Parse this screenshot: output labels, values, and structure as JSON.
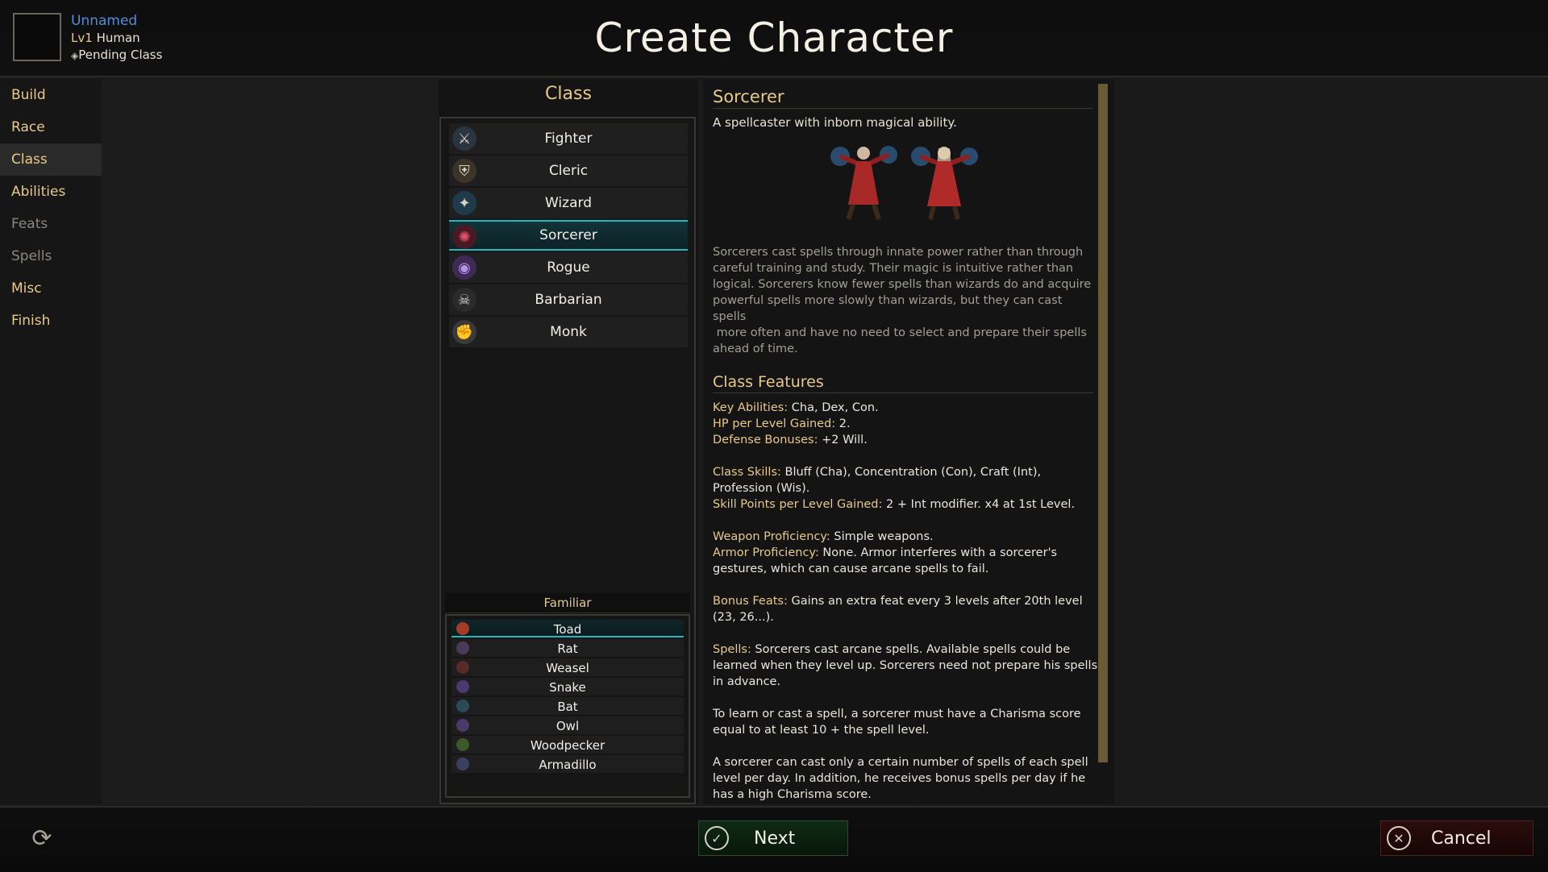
{
  "header": {
    "char_name": "Unnamed",
    "level_prefix": "Lv1",
    "race": "Human",
    "pending_class": "Pending Class",
    "title": "Create Character"
  },
  "nav": {
    "items": [
      {
        "label": "Build",
        "state": "enabled"
      },
      {
        "label": "Race",
        "state": "enabled"
      },
      {
        "label": "Class",
        "state": "active"
      },
      {
        "label": "Abilities",
        "state": "enabled"
      },
      {
        "label": "Feats",
        "state": "disabled"
      },
      {
        "label": "Spells",
        "state": "disabled"
      },
      {
        "label": "Misc",
        "state": "enabled"
      },
      {
        "label": "Finish",
        "state": "enabled"
      }
    ]
  },
  "class_panel": {
    "header": "Class",
    "classes": [
      {
        "label": "Fighter",
        "icon": "sword-icon"
      },
      {
        "label": "Cleric",
        "icon": "shield-icon"
      },
      {
        "label": "Wizard",
        "icon": "spellbook-icon"
      },
      {
        "label": "Sorcerer",
        "icon": "fire-hands-icon",
        "selected": true
      },
      {
        "label": "Rogue",
        "icon": "hood-icon"
      },
      {
        "label": "Barbarian",
        "icon": "skull-icon"
      },
      {
        "label": "Monk",
        "icon": "fist-icon"
      }
    ],
    "familiar_header": "Familiar",
    "familiars": [
      {
        "label": "Toad",
        "selected": true
      },
      {
        "label": "Rat"
      },
      {
        "label": "Weasel"
      },
      {
        "label": "Snake"
      },
      {
        "label": "Bat"
      },
      {
        "label": "Owl"
      },
      {
        "label": "Woodpecker"
      },
      {
        "label": "Armadillo"
      }
    ]
  },
  "description": {
    "title": "Sorcerer",
    "subtitle": "A spellcaster with inborn magical ability.",
    "paragraph_lines": [
      "Sorcerers cast spells through innate power rather than through",
      "careful training and study. Their magic is intuitive rather than",
      "logical. Sorcerers know fewer spells than wizards do and acquire",
      "powerful spells more slowly than wizards, but they can cast spells",
      " more often and have no need to select and prepare their spells",
      "ahead of time."
    ],
    "features_title": "Class Features",
    "features": [
      {
        "key": "Key Abilities:",
        "text": " Cha, Dex, Con."
      },
      {
        "key": "HP per Level Gained:",
        "text": " 2."
      },
      {
        "key": "Defense Bonuses:",
        "text": " +2 Will."
      },
      {
        "key": "Class Skills:",
        "text": " Bluff (Cha), Concentration (Con), Craft (Int),"
      },
      {
        "key": "",
        "text": "Profession (Wis)."
      },
      {
        "key": "Skill Points per Level Gained:",
        "text": " 2 + Int modifier. x4 at 1st Level."
      },
      {
        "key": "Weapon Proficiency:",
        "text": " Simple weapons."
      },
      {
        "key": "Armor Proficiency:",
        "text": " None. Armor interferes with a sorcerer's"
      },
      {
        "key": "",
        "text": "gestures, which can cause arcane spells to fail."
      },
      {
        "key": "Bonus Feats:",
        "text": " Gains an extra feat every 3 levels after 20th level"
      },
      {
        "key": "",
        "text": "(23, 26...)."
      },
      {
        "key": "Spells:",
        "text": " Sorcerers cast arcane spells. Available spells could be"
      },
      {
        "key": "",
        "text": "learned when they level up. Sorcerers need not prepare his spells"
      },
      {
        "key": "",
        "text": "in advance."
      },
      {
        "key": "",
        "text": "To learn or cast a spell, a sorcerer must have a Charisma score"
      },
      {
        "key": "",
        "text": "equal to at least 10 + the spell level."
      },
      {
        "key": "",
        "text": "A sorcerer can cast only a certain number of spells of each spell"
      },
      {
        "key": "",
        "text": "level per day. In addition, he receives bonus spells per day if he"
      },
      {
        "key": "",
        "text": "has a high Charisma score."
      }
    ]
  },
  "footer": {
    "next_label": "Next",
    "cancel_label": "Cancel"
  },
  "colors": {
    "accent_gold": "#e8c98a",
    "selection_teal": "#23b8c0",
    "name_blue": "#4f8fd8"
  }
}
